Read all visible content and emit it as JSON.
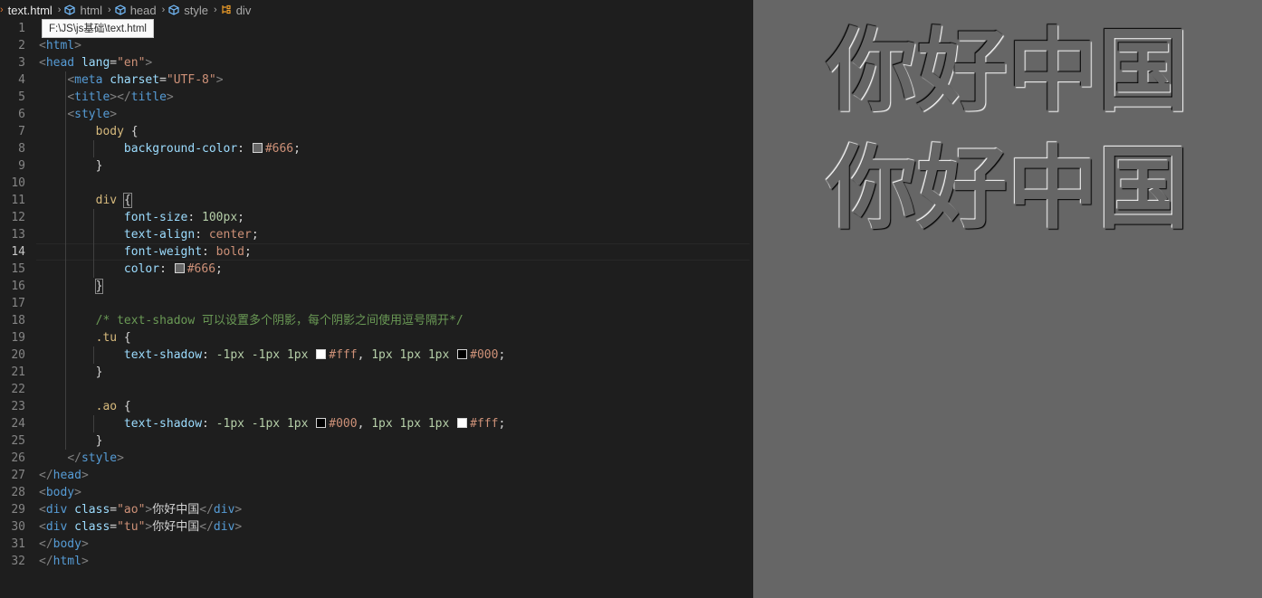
{
  "breadcrumb": {
    "file": "text.html",
    "items": [
      "html",
      "head",
      "style",
      "div"
    ]
  },
  "tooltip": "F:\\JS\\js基础\\text.html",
  "editor": {
    "active_line": 14,
    "lines": [
      {
        "n": "1",
        "tokens": []
      },
      {
        "n": "2",
        "tokens": [
          [
            "tk-br",
            "<"
          ],
          [
            "tk-tag",
            "html"
          ],
          [
            "tk-br",
            ">"
          ]
        ]
      },
      {
        "n": "3",
        "tokens": [
          [
            "tk-br",
            "<"
          ],
          [
            "tk-tag",
            "head"
          ],
          [
            "tk-txt",
            " "
          ],
          [
            "tk-attr",
            "lang"
          ],
          [
            "tk-punc",
            "="
          ],
          [
            "tk-str",
            "\"en\""
          ],
          [
            "tk-br",
            ">"
          ]
        ]
      },
      {
        "n": "4",
        "tokens": [
          [
            "tk-txt",
            "    "
          ],
          [
            "tk-br",
            "<"
          ],
          [
            "tk-tag",
            "meta"
          ],
          [
            "tk-txt",
            " "
          ],
          [
            "tk-attr",
            "charset"
          ],
          [
            "tk-punc",
            "="
          ],
          [
            "tk-str",
            "\"UTF-8\""
          ],
          [
            "tk-br",
            ">"
          ]
        ]
      },
      {
        "n": "5",
        "tokens": [
          [
            "tk-txt",
            "    "
          ],
          [
            "tk-br",
            "<"
          ],
          [
            "tk-tag",
            "title"
          ],
          [
            "tk-br",
            "></"
          ],
          [
            "tk-tag",
            "title"
          ],
          [
            "tk-br",
            ">"
          ]
        ]
      },
      {
        "n": "6",
        "tokens": [
          [
            "tk-txt",
            "    "
          ],
          [
            "tk-br",
            "<"
          ],
          [
            "tk-tag",
            "style"
          ],
          [
            "tk-br",
            ">"
          ]
        ]
      },
      {
        "n": "7",
        "tokens": [
          [
            "tk-txt",
            "        "
          ],
          [
            "tk-sel",
            "body"
          ],
          [
            "tk-punc",
            " {"
          ]
        ]
      },
      {
        "n": "8",
        "tokens": [
          [
            "tk-txt",
            "            "
          ],
          [
            "tk-prop",
            "background-color"
          ],
          [
            "tk-punc",
            ": "
          ],
          [
            "swatch",
            "#666666"
          ],
          [
            "tk-val",
            "#666"
          ],
          [
            "tk-punc",
            ";"
          ]
        ]
      },
      {
        "n": "9",
        "tokens": [
          [
            "tk-txt",
            "        "
          ],
          [
            "tk-punc",
            "}"
          ]
        ]
      },
      {
        "n": "10",
        "tokens": []
      },
      {
        "n": "11",
        "tokens": [
          [
            "tk-txt",
            "        "
          ],
          [
            "tk-sel",
            "div"
          ],
          [
            "tk-txt",
            " "
          ],
          [
            "box",
            "{"
          ]
        ]
      },
      {
        "n": "12",
        "tokens": [
          [
            "tk-txt",
            "            "
          ],
          [
            "tk-prop",
            "font-size"
          ],
          [
            "tk-punc",
            ": "
          ],
          [
            "tk-num",
            "100px"
          ],
          [
            "tk-punc",
            ";"
          ]
        ]
      },
      {
        "n": "13",
        "tokens": [
          [
            "tk-txt",
            "            "
          ],
          [
            "tk-prop",
            "text-align"
          ],
          [
            "tk-punc",
            ": "
          ],
          [
            "tk-val",
            "center"
          ],
          [
            "tk-punc",
            ";"
          ]
        ]
      },
      {
        "n": "14",
        "tokens": [
          [
            "tk-txt",
            "            "
          ],
          [
            "tk-prop",
            "font-weight"
          ],
          [
            "tk-punc",
            ": "
          ],
          [
            "tk-val",
            "bold"
          ],
          [
            "tk-punc",
            ";"
          ]
        ]
      },
      {
        "n": "15",
        "tokens": [
          [
            "tk-txt",
            "            "
          ],
          [
            "tk-prop",
            "color"
          ],
          [
            "tk-punc",
            ": "
          ],
          [
            "swatch",
            "#666666"
          ],
          [
            "tk-val",
            "#666"
          ],
          [
            "tk-punc",
            ";"
          ]
        ]
      },
      {
        "n": "16",
        "tokens": [
          [
            "tk-txt",
            "        "
          ],
          [
            "box",
            "}"
          ]
        ]
      },
      {
        "n": "17",
        "tokens": []
      },
      {
        "n": "18",
        "tokens": [
          [
            "tk-txt",
            "        "
          ],
          [
            "tk-com",
            "/* text-shadow 可以设置多个阴影，每个阴影之间使用逗号隔开*/"
          ]
        ]
      },
      {
        "n": "19",
        "tokens": [
          [
            "tk-txt",
            "        "
          ],
          [
            "tk-sel",
            ".tu"
          ],
          [
            "tk-punc",
            " {"
          ]
        ]
      },
      {
        "n": "20",
        "tokens": [
          [
            "tk-txt",
            "            "
          ],
          [
            "tk-prop",
            "text-shadow"
          ],
          [
            "tk-punc",
            ": "
          ],
          [
            "tk-num",
            "-1px -1px 1px "
          ],
          [
            "swatch",
            "#ffffff"
          ],
          [
            "tk-val",
            "#fff"
          ],
          [
            "tk-punc",
            ", "
          ],
          [
            "tk-num",
            "1px 1px 1px "
          ],
          [
            "swatch",
            "#000000"
          ],
          [
            "tk-val",
            "#000"
          ],
          [
            "tk-punc",
            ";"
          ]
        ]
      },
      {
        "n": "21",
        "tokens": [
          [
            "tk-txt",
            "        "
          ],
          [
            "tk-punc",
            "}"
          ]
        ]
      },
      {
        "n": "22",
        "tokens": []
      },
      {
        "n": "23",
        "tokens": [
          [
            "tk-txt",
            "        "
          ],
          [
            "tk-sel",
            ".ao"
          ],
          [
            "tk-punc",
            " {"
          ]
        ]
      },
      {
        "n": "24",
        "tokens": [
          [
            "tk-txt",
            "            "
          ],
          [
            "tk-prop",
            "text-shadow"
          ],
          [
            "tk-punc",
            ": "
          ],
          [
            "tk-num",
            "-1px -1px 1px "
          ],
          [
            "swatch",
            "#000000"
          ],
          [
            "tk-val",
            "#000"
          ],
          [
            "tk-punc",
            ", "
          ],
          [
            "tk-num",
            "1px 1px 1px "
          ],
          [
            "swatch",
            "#ffffff"
          ],
          [
            "tk-val",
            "#fff"
          ],
          [
            "tk-punc",
            ";"
          ]
        ]
      },
      {
        "n": "25",
        "tokens": [
          [
            "tk-txt",
            "        "
          ],
          [
            "tk-punc",
            "}"
          ]
        ]
      },
      {
        "n": "26",
        "tokens": [
          [
            "tk-txt",
            "    "
          ],
          [
            "tk-br",
            "</"
          ],
          [
            "tk-tag",
            "style"
          ],
          [
            "tk-br",
            ">"
          ]
        ]
      },
      {
        "n": "27",
        "tokens": [
          [
            "tk-br",
            "</"
          ],
          [
            "tk-tag",
            "head"
          ],
          [
            "tk-br",
            ">"
          ]
        ]
      },
      {
        "n": "28",
        "tokens": [
          [
            "tk-br",
            "<"
          ],
          [
            "tk-tag",
            "body"
          ],
          [
            "tk-br",
            ">"
          ]
        ]
      },
      {
        "n": "29",
        "tokens": [
          [
            "tk-br",
            "<"
          ],
          [
            "tk-tag",
            "div"
          ],
          [
            "tk-txt",
            " "
          ],
          [
            "tk-attr",
            "class"
          ],
          [
            "tk-punc",
            "="
          ],
          [
            "tk-str",
            "\"ao\""
          ],
          [
            "tk-br",
            ">"
          ],
          [
            "tk-txt",
            "你好中国"
          ],
          [
            "tk-br",
            "</"
          ],
          [
            "tk-tag",
            "div"
          ],
          [
            "tk-br",
            ">"
          ]
        ]
      },
      {
        "n": "30",
        "tokens": [
          [
            "tk-br",
            "<"
          ],
          [
            "tk-tag",
            "div"
          ],
          [
            "tk-txt",
            " "
          ],
          [
            "tk-attr",
            "class"
          ],
          [
            "tk-punc",
            "="
          ],
          [
            "tk-str",
            "\"tu\""
          ],
          [
            "tk-br",
            ">"
          ],
          [
            "tk-txt",
            "你好中国"
          ],
          [
            "tk-br",
            "</"
          ],
          [
            "tk-tag",
            "div"
          ],
          [
            "tk-br",
            ">"
          ]
        ]
      },
      {
        "n": "31",
        "tokens": [
          [
            "tk-br",
            "</"
          ],
          [
            "tk-tag",
            "body"
          ],
          [
            "tk-br",
            ">"
          ]
        ]
      },
      {
        "n": "32",
        "tokens": [
          [
            "tk-br",
            "</"
          ],
          [
            "tk-tag",
            "html"
          ],
          [
            "tk-br",
            ">"
          ]
        ]
      }
    ]
  },
  "preview": {
    "ao_text": "你好中国",
    "tu_text": "你好中国",
    "background": "#666666"
  }
}
